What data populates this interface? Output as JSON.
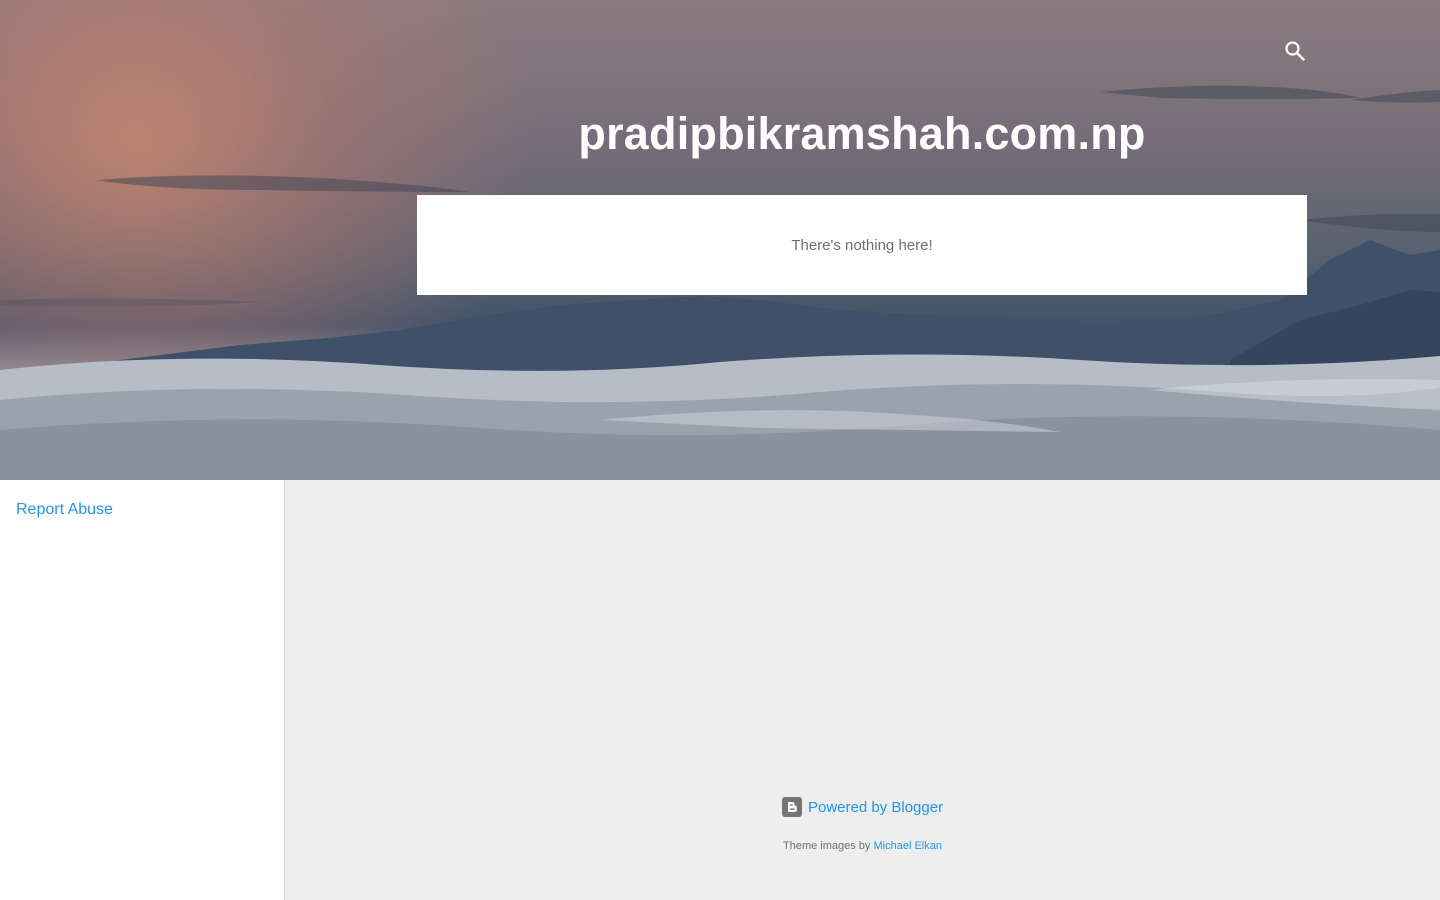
{
  "header": {
    "title": "pradipbikramshah.com.np",
    "search_icon": "search-icon"
  },
  "main": {
    "empty_message": "There's nothing here!"
  },
  "sidebar": {
    "report_abuse": "Report Abuse"
  },
  "footer": {
    "powered_by": "Powered by Blogger",
    "blogger_icon": "blogger-icon",
    "theme_images_prefix": "Theme images by",
    "theme_images_author": "Michael Elkan"
  },
  "colors": {
    "link": "#2196f3",
    "body_bg": "#eeeeee",
    "muted_text": "#707070"
  }
}
